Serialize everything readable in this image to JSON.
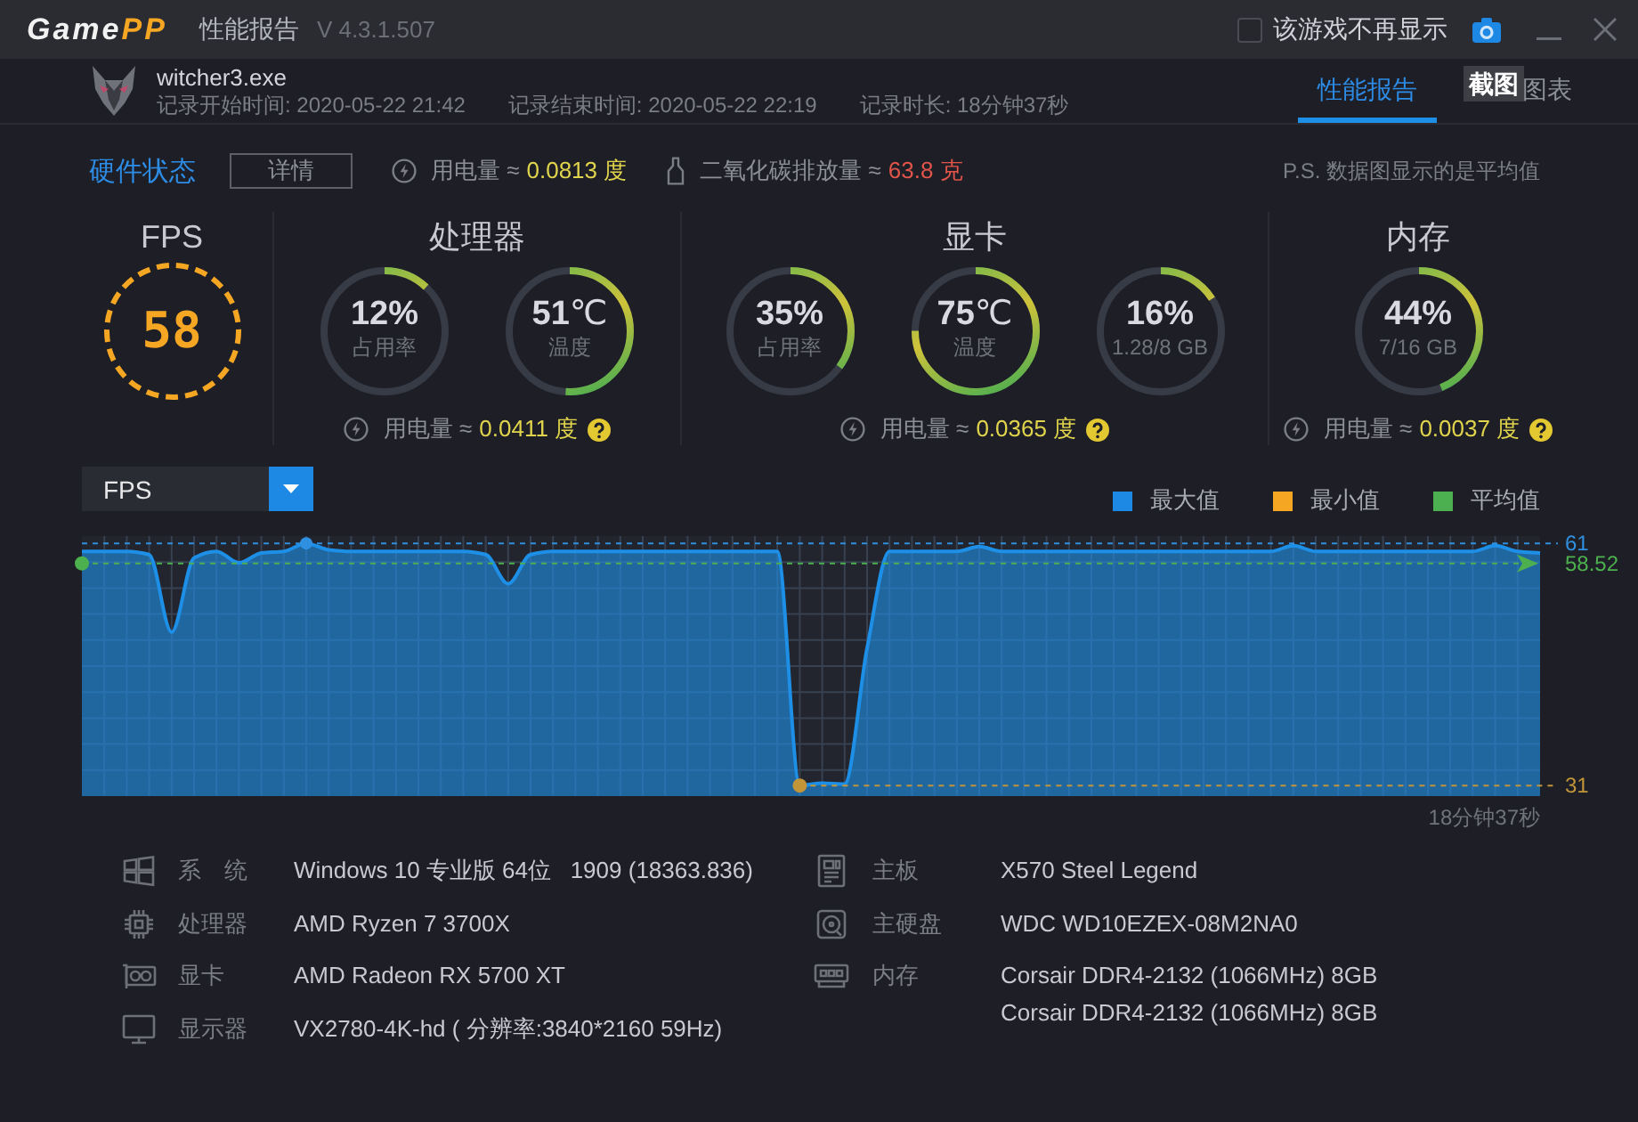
{
  "title_bar": {
    "logo": [
      "Game",
      "PP"
    ],
    "title": "性能报告",
    "version": "V 4.3.1.507",
    "hide_option": {
      "label": "该游戏不再显示",
      "checked": false
    }
  },
  "header": {
    "app_name": "witcher3.exe",
    "start_time": "记录开始时间: 2020-05-22 21:42",
    "end_time": "记录结束时间: 2020-05-22 22:19",
    "duration": "记录时长: 18分钟37秒",
    "tabs": [
      {
        "label": "性能报告",
        "selected": true
      },
      {
        "label": "图表",
        "selected": false
      }
    ],
    "tooltip": "截图"
  },
  "hardware_status": {
    "title": "硬件状态",
    "details_button": "详情",
    "power": {
      "label": "用电量 ≈",
      "value": "0.0813 度"
    },
    "emission": {
      "label": "二氧化碳排放量 ≈",
      "value": "63.8 克"
    },
    "note": "P.S. 数据图显示的是平均值"
  },
  "sections": [
    {
      "kind": "fps",
      "title": "FPS",
      "value": "58"
    },
    {
      "kind": "gauges",
      "title": "处理器",
      "gauges": [
        {
          "value": "12%",
          "caption": "占用率",
          "level": 0.12
        },
        {
          "value": "51",
          "unit": "℃",
          "caption": "温度",
          "level": 0.51
        }
      ],
      "power": {
        "label": "用电量 ≈",
        "value": "0.0411 度"
      }
    },
    {
      "kind": "gauges",
      "title": "显卡",
      "gauges": [
        {
          "value": "35%",
          "caption": "占用率",
          "level": 0.35
        },
        {
          "value": "75",
          "unit": "℃",
          "caption": "温度",
          "level": 0.75
        },
        {
          "value": "16%",
          "caption": "1.28/8 GB",
          "level": 0.16
        }
      ],
      "power": {
        "label": "用电量 ≈",
        "value": "0.0365 度"
      }
    },
    {
      "kind": "gauges",
      "title": "内存",
      "gauges": [
        {
          "value": "44%",
          "caption": "7/16 GB",
          "level": 0.44
        }
      ],
      "power": {
        "label": "用电量 ≈",
        "value": "0.0037 度"
      }
    }
  ],
  "chart": {
    "legend": [
      {
        "label": "最大值",
        "color": "#1e88e5"
      },
      {
        "label": "最小值",
        "color": "#f5a623"
      },
      {
        "label": "平均值",
        "color": "#4caf50"
      }
    ],
    "chart_data": {
      "type": "area",
      "grid": true,
      "series": [
        {
          "name": "FPS",
          "color": "#1e8fe6",
          "values": [
            60,
            60,
            60,
            59.6,
            50,
            59.2,
            60,
            58.6,
            59.8,
            60,
            61,
            60.2,
            60,
            60,
            60,
            60,
            60,
            60,
            59.6,
            56,
            59.6,
            60,
            60,
            60,
            60,
            60,
            60,
            60,
            60,
            60,
            60,
            60,
            31,
            31.3,
            31.2,
            48,
            60,
            60,
            60,
            60,
            60.6,
            60,
            60,
            60,
            60,
            60,
            60,
            60,
            60,
            60,
            60,
            60,
            60,
            60,
            60.7,
            60,
            60,
            60,
            60,
            60,
            60,
            60,
            60,
            60.7,
            60,
            59.8
          ]
        }
      ],
      "ylim": [
        29.7,
        61.9
      ],
      "yticks": [
        {
          "value": 31,
          "label": "31"
        },
        {
          "value": 61,
          "label": "61"
        }
      ],
      "ref_lines": [
        {
          "axis": "y",
          "value": 61,
          "color": "#2f8fe0"
        },
        {
          "axis": "y",
          "value": 58.52,
          "label": "58.52",
          "color": "#4cb04f"
        },
        {
          "axis": "y",
          "value": 31,
          "color": "#c29538"
        }
      ]
    },
    "end_time": "18分钟37秒"
  },
  "system_info": {
    "left": [
      {
        "kind": "windows",
        "label": "系　统",
        "values": [
          "Windows 10 专业版 64位   1909 (18363.836)"
        ]
      },
      {
        "kind": "cpu",
        "label": "处理器",
        "values": [
          "AMD Ryzen 7 3700X"
        ]
      },
      {
        "kind": "gpu",
        "label": "显卡",
        "values": [
          "AMD Radeon RX 5700 XT"
        ]
      },
      {
        "kind": "monitor",
        "label": "显示器",
        "values": [
          "VX2780-4K-hd ( 分辨率:3840*2160 59Hz)"
        ]
      }
    ],
    "right": [
      {
        "kind": "motherboard",
        "label": "主板",
        "values": [
          "X570 Steel Legend"
        ]
      },
      {
        "kind": "disk",
        "label": "主硬盘",
        "values": [
          "WDC WD10EZEX-08M2NA0"
        ]
      },
      {
        "kind": "memory",
        "label": "内存",
        "values": [
          "Corsair DDR4-2132 (1066MHz) 8GB",
          "Corsair DDR4-2132 (1066MHz) 8GB"
        ]
      }
    ]
  }
}
